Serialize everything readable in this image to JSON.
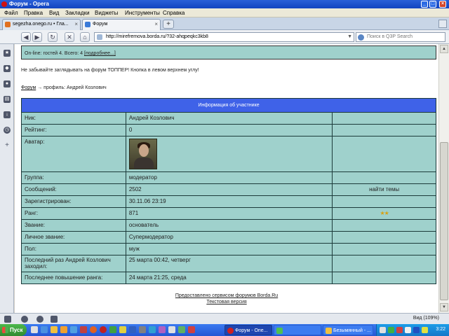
{
  "window": {
    "title": "Форум - Opera"
  },
  "menu": [
    "Файл",
    "Правка",
    "Вид",
    "Закладки",
    "Виджеты",
    "Инструменты",
    "Справка"
  ],
  "tabs": [
    {
      "label": "segezha.onego.ru • Гла..."
    },
    {
      "label": "Форум"
    }
  ],
  "address": {
    "url": "http://mirefremova.borda.ru/?32-ahqpeqkc3kb8",
    "search_placeholder": "Поиск в Q3P Search"
  },
  "online": {
    "text": "On-line: гостей 4. Всего: 4 ",
    "more_link": "[подробнее...]"
  },
  "notice": "Не забывайте заглядывать на форум ТОППЕР! Кнопка в левом верхнем углу!",
  "breadcrumb": {
    "link": "Форум",
    "rest": " → профиль: Андрей Козлович"
  },
  "profile": {
    "header": "Информация об участнике",
    "rows": [
      {
        "label": "Ник:",
        "value": "Андрей Козлович",
        "extra": ""
      },
      {
        "label": "Рейтинг:",
        "value": "0",
        "extra": ""
      },
      {
        "label": "Аватар:",
        "value": "",
        "extra": ""
      },
      {
        "label": "Группа:",
        "value": "модератор",
        "extra": ""
      },
      {
        "label": "Сообщений:",
        "value": "2502",
        "extra": "найти темы"
      },
      {
        "label": "Зарегистрирован:",
        "value": "30.11.06 23:19",
        "extra": ""
      },
      {
        "label": "Ранг:",
        "value": "871",
        "extra": "★★"
      },
      {
        "label": "Звание:",
        "value": "основатель",
        "extra": ""
      },
      {
        "label": "Личное звание:",
        "value": "Супермодератор",
        "extra": ""
      },
      {
        "label": "Пол:",
        "value": "муж",
        "extra": ""
      },
      {
        "label": "Последний раз Андрей Козлович заходил:",
        "value": "25 марта 00:42, четверг",
        "extra": ""
      },
      {
        "label": "Последнее повышение ранга:",
        "value": "24 марта 21:25, среда",
        "extra": ""
      }
    ]
  },
  "footer": {
    "line1": "Предоставлено сервисом форумов Borda.Ru",
    "line2": "Текстовая версия"
  },
  "status": {
    "zoom": "Вид (109%)"
  },
  "taskbar": {
    "start": "Пуск",
    "tasks": [
      {
        "label": "Форум - Опе..."
      },
      {
        "label": ""
      },
      {
        "label": "Безымянный - ..."
      }
    ],
    "clock": "3:22"
  },
  "colors": {
    "table_bg": "#9fd1cc",
    "header_bg": "#3f62e8",
    "titlebar": "#2458d8",
    "stars": "#d8a010"
  }
}
